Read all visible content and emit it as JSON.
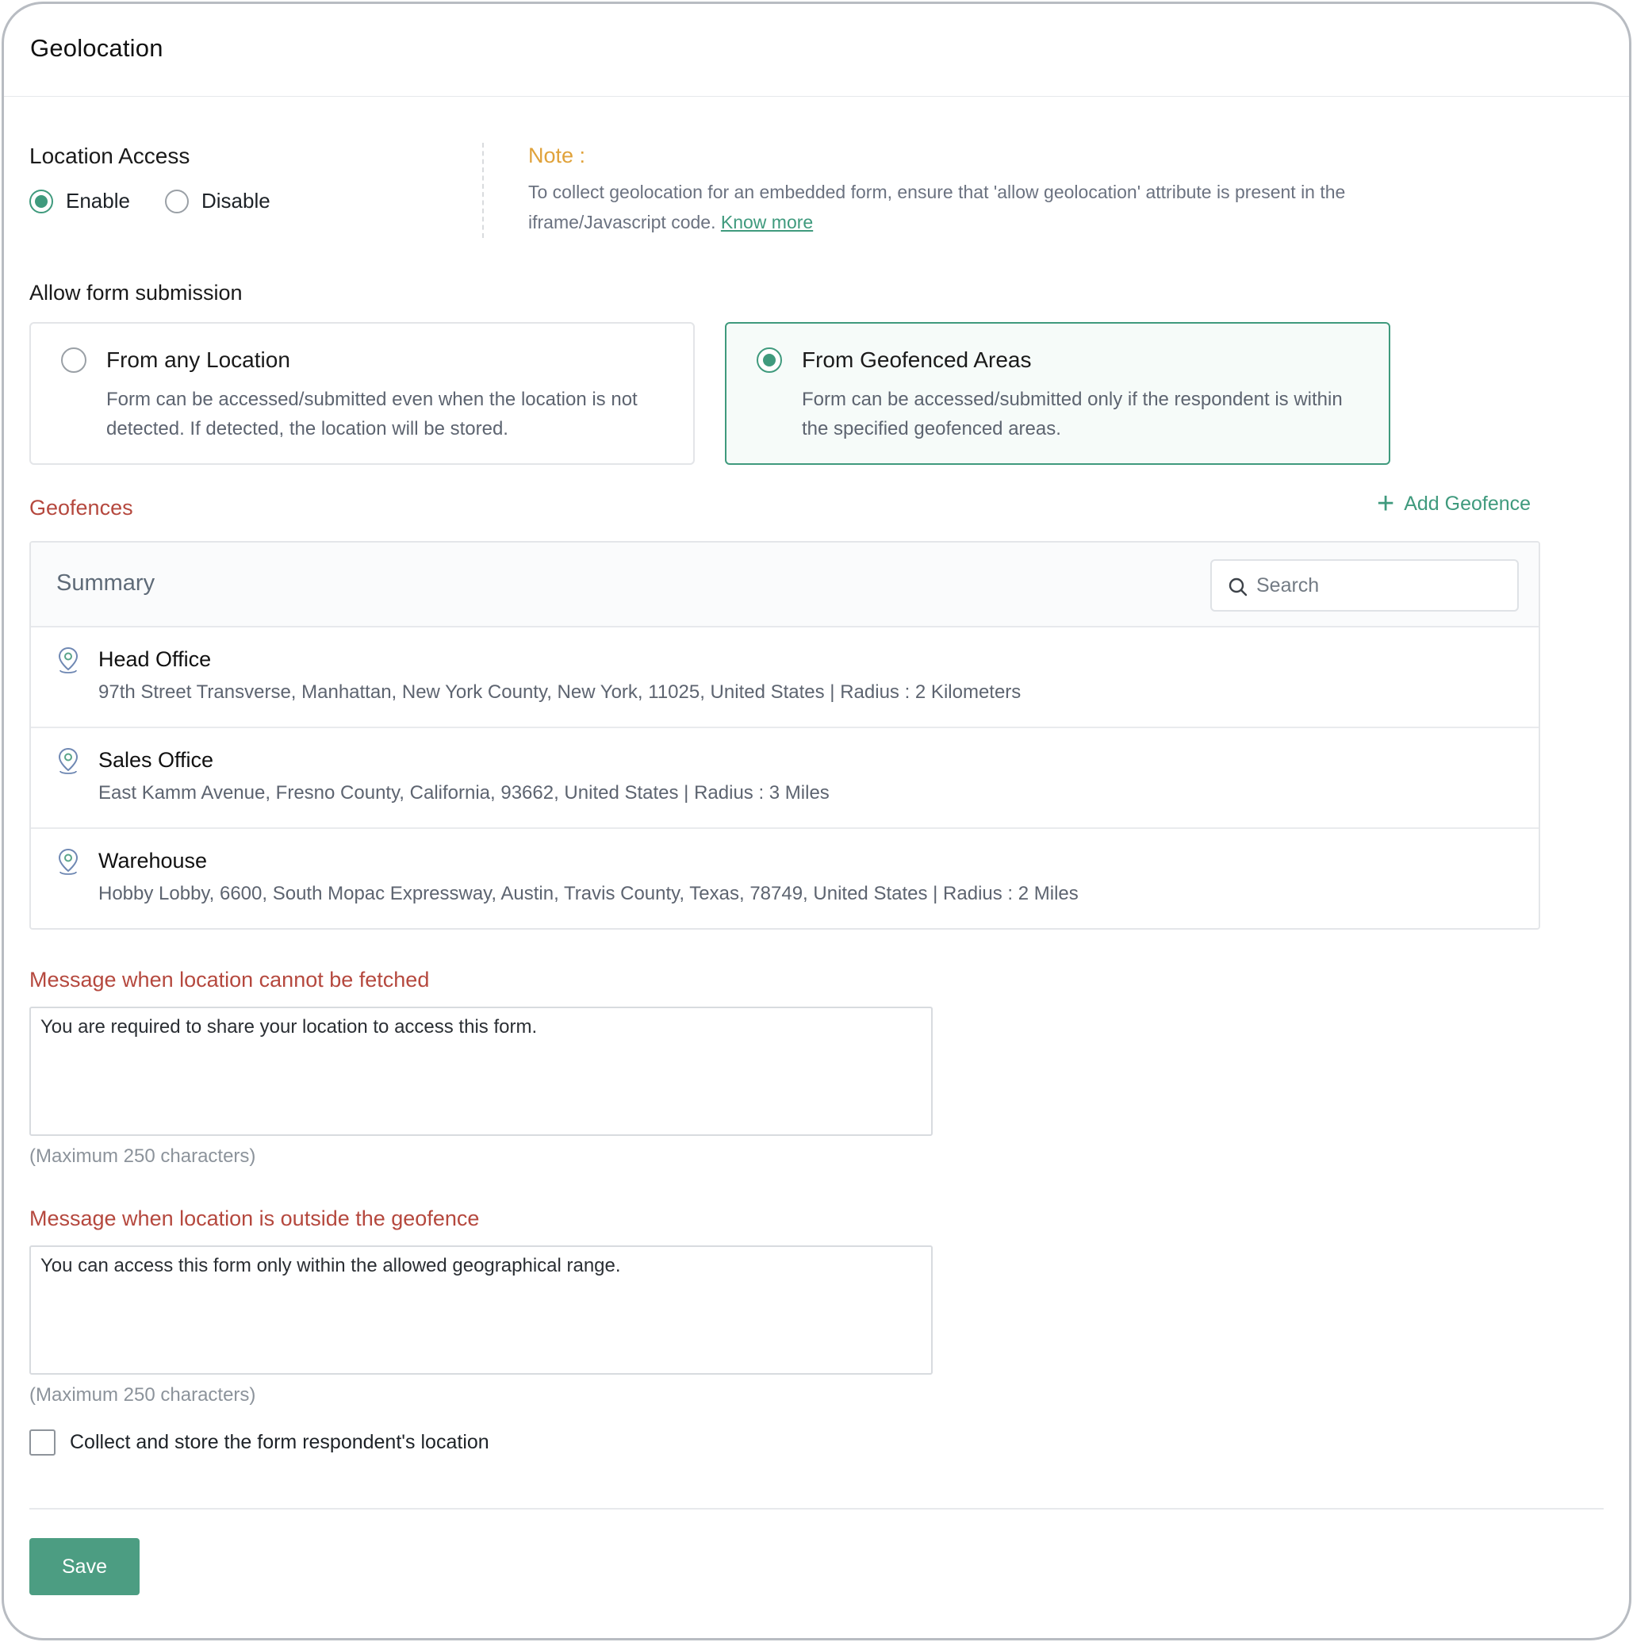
{
  "header": {
    "title": "Geolocation"
  },
  "location_access": {
    "label": "Location Access",
    "options": [
      {
        "label": "Enable",
        "selected": true
      },
      {
        "label": "Disable",
        "selected": false
      }
    ]
  },
  "note": {
    "title": "Note :",
    "text": "To collect geolocation for an embedded form, ensure that 'allow geolocation' attribute is present in the iframe/Javascript code.",
    "link": "Know more"
  },
  "allow_submission": {
    "label": "Allow form submission",
    "options": [
      {
        "title": "From any Location",
        "description": "Form can be accessed/submitted even when the location is not detected. If detected, the location will be stored.",
        "selected": false
      },
      {
        "title": "From Geofenced Areas",
        "description": "Form can be accessed/submitted only if the respondent is within the specified geofenced areas.",
        "selected": true
      }
    ]
  },
  "geofences": {
    "label": "Geofences",
    "add_label": "Add Geofence",
    "summary_label": "Summary",
    "search_placeholder": "Search",
    "items": [
      {
        "name": "Head Office",
        "address": "97th Street Transverse, Manhattan, New York County, New York, 11025, United States | Radius : 2 Kilometers"
      },
      {
        "name": "Sales Office",
        "address": "East Kamm Avenue, Fresno County, California, 93662, United States | Radius : 3 Miles"
      },
      {
        "name": "Warehouse",
        "address": "Hobby Lobby, 6600, South Mopac Expressway, Austin, Travis County, Texas, 78749, United States | Radius : 2 Miles"
      }
    ]
  },
  "messages": {
    "not_fetched": {
      "label": "Message when location cannot be fetched",
      "value": "You are required to share your location to access this form.",
      "hint": "(Maximum 250 characters)"
    },
    "outside": {
      "label": "Message when location is outside the geofence",
      "value": "You can access this form only within the allowed geographical range.",
      "hint": "(Maximum 250 characters)"
    }
  },
  "collect_location": {
    "label": "Collect and store the form respondent's location",
    "checked": false
  },
  "actions": {
    "save_label": "Save"
  },
  "colors": {
    "accent": "#3f9a7d",
    "section_label": "#b5483e",
    "note_title": "#e0a23a",
    "save_button": "#4c9d82"
  },
  "icons": {
    "geofence_item": "location-pin-icon",
    "search": "search-icon",
    "add": "plus-icon"
  }
}
